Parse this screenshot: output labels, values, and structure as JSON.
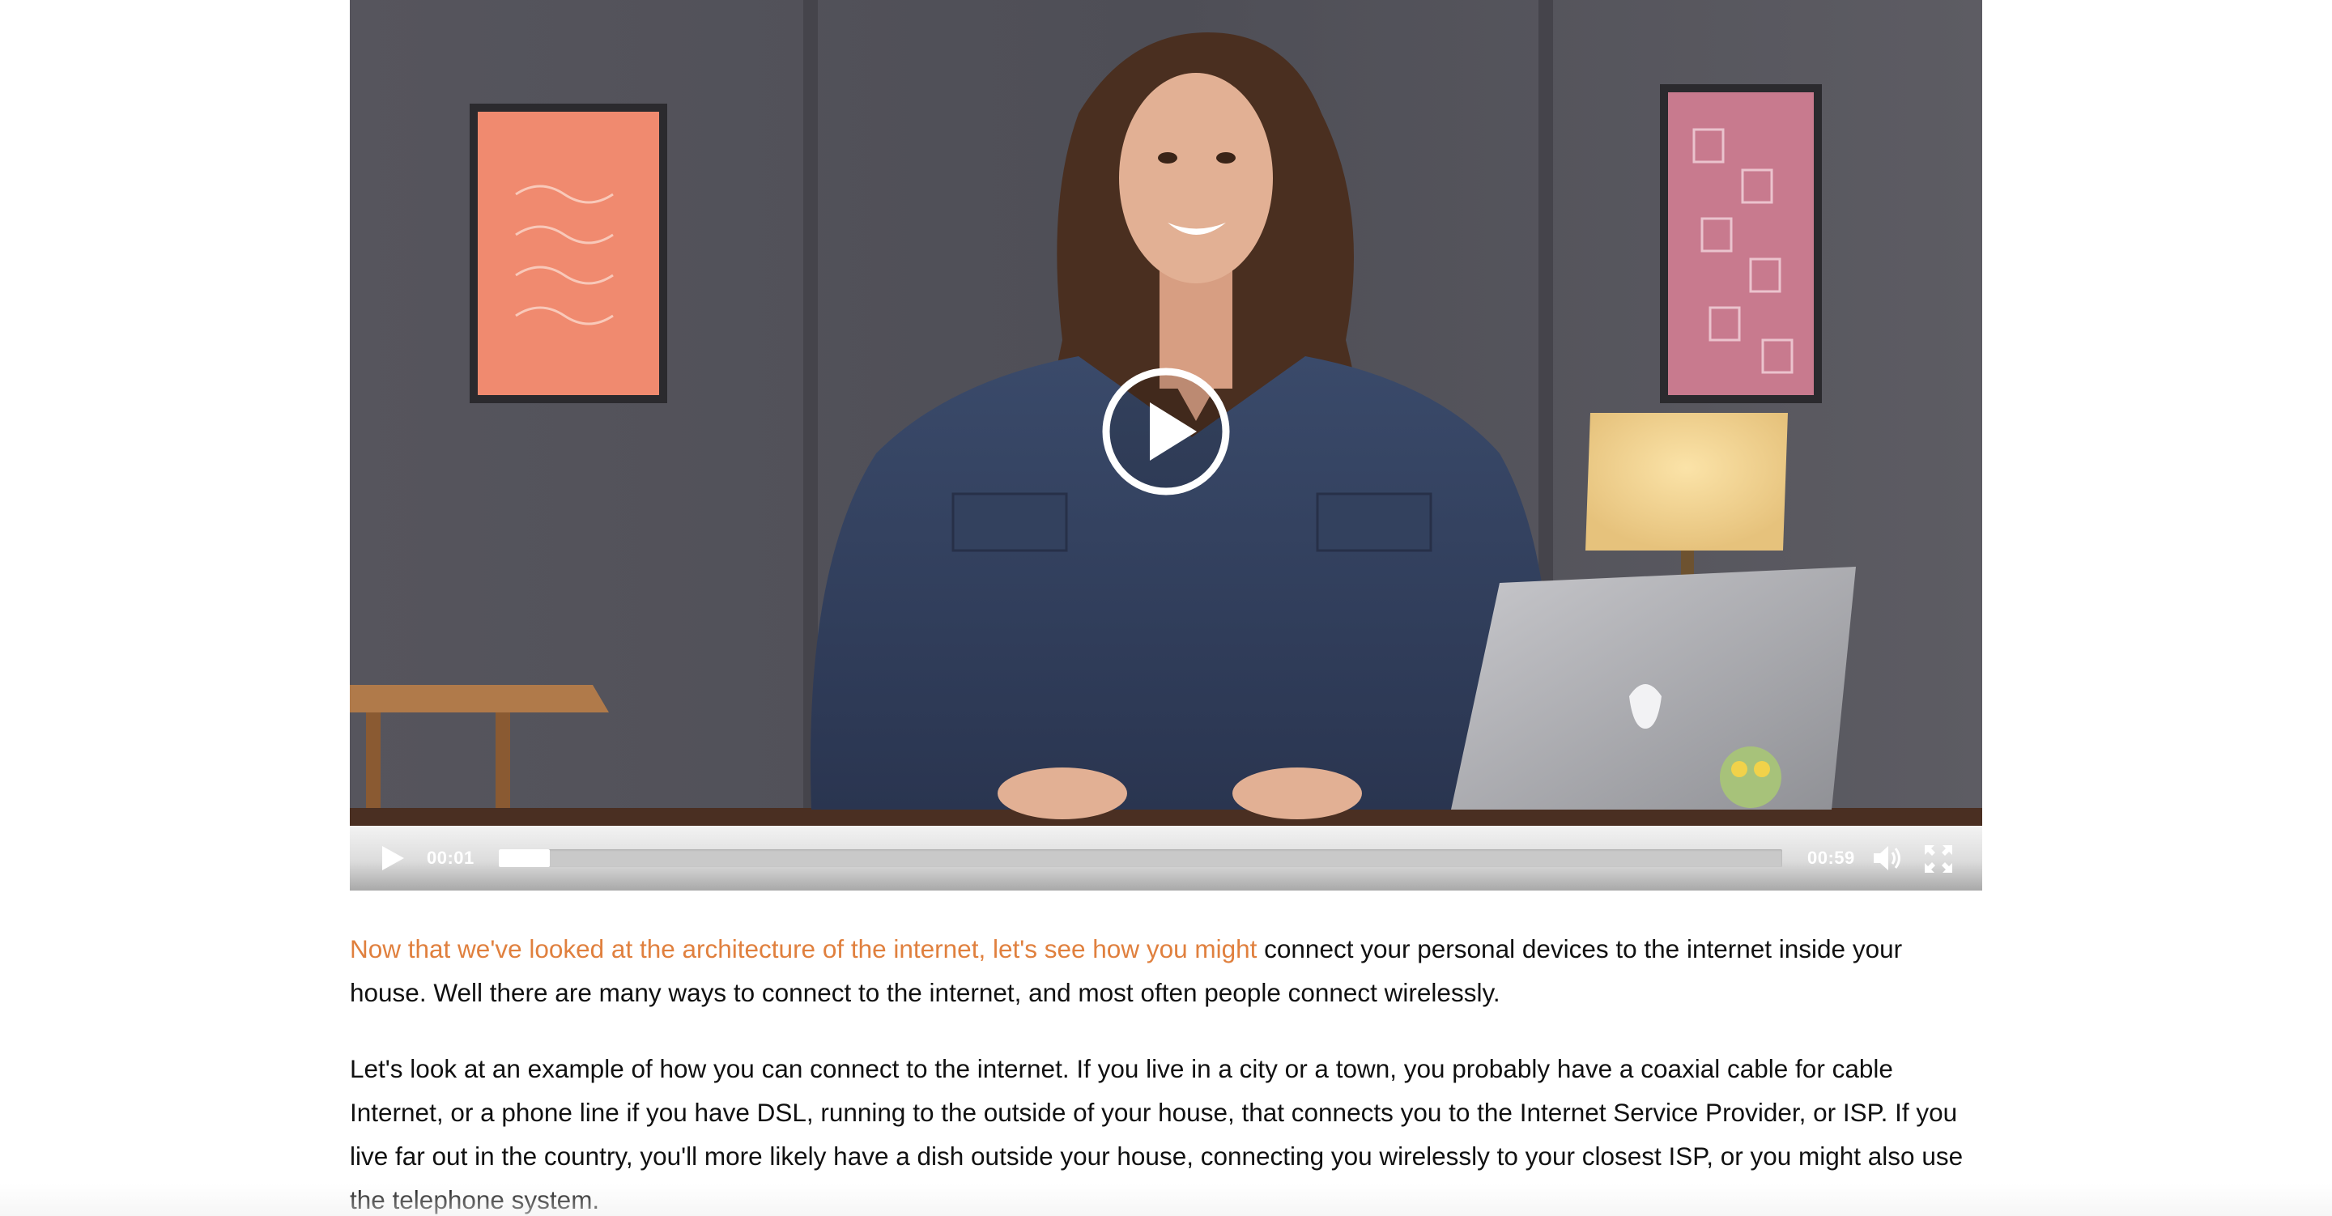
{
  "video": {
    "current_time": "00:01",
    "duration": "00:59",
    "progress_fraction": 0.04
  },
  "icons": {
    "big_play": "play-circle-icon",
    "play": "play-icon",
    "volume": "volume-icon",
    "fullscreen": "fullscreen-icon"
  },
  "colors": {
    "highlight": "#e0803e",
    "text": "#111111"
  },
  "transcript": {
    "p1_highlight": "Now that we've looked at the architecture of the internet, let's see how you might",
    "p1_rest": " connect your personal devices to the internet inside your house. Well there are many ways to connect to the internet, and most often people connect wirelessly.",
    "p2": "Let's look at an example of how you can connect to the internet. If you live in a city or a town, you probably have a coaxial cable for cable Internet, or a phone line if you have DSL, running to the outside of your house, that connects you to the Internet Service Provider, or ISP. If you live far out in the country, you'll more likely have a dish outside your house, connecting you wirelessly to your closest ISP, or you might also use the telephone system."
  }
}
